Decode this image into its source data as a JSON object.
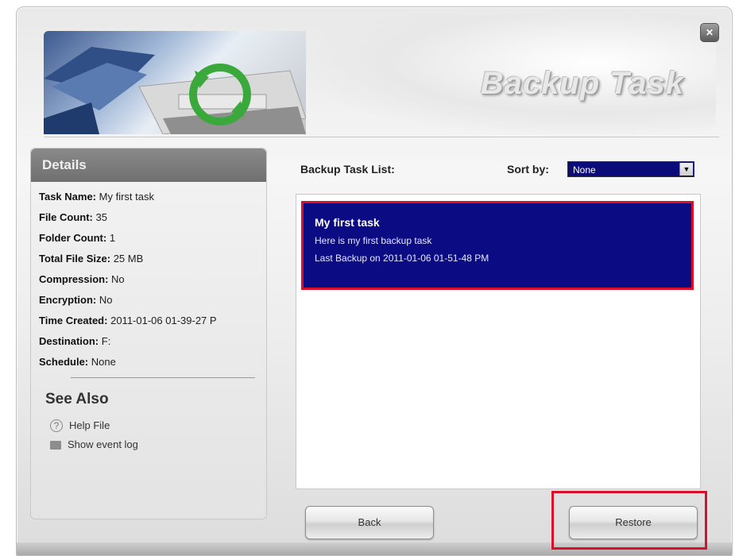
{
  "window": {
    "title": "Backup Task",
    "close_label": "✕"
  },
  "details": {
    "header": "Details",
    "rows": [
      {
        "label": "Task Name:",
        "value": "My first task"
      },
      {
        "label": "File Count:",
        "value": "35"
      },
      {
        "label": "Folder Count:",
        "value": "1"
      },
      {
        "label": "Total File Size:",
        "value": "25 MB"
      },
      {
        "label": "Compression:",
        "value": "No"
      },
      {
        "label": "Encryption:",
        "value": "No"
      },
      {
        "label": "Time Created:",
        "value": "2011-01-06 01-39-27 P"
      },
      {
        "label": "Destination:",
        "value": "F:"
      },
      {
        "label": "Schedule:",
        "value": "None"
      }
    ],
    "see_also": {
      "title": "See Also",
      "items": [
        {
          "label": "Help File",
          "icon": "help-icon"
        },
        {
          "label": "Show event log",
          "icon": "event-log-icon"
        }
      ]
    }
  },
  "task_list": {
    "label": "Backup Task List:",
    "sort_label": "Sort by:",
    "sort_value": "None",
    "items": [
      {
        "name": "My first task",
        "description": "Here is my first backup task",
        "last_backup": "Last Backup on 2011-01-06 01-51-48 PM"
      }
    ]
  },
  "buttons": {
    "back": "Back",
    "restore": "Restore"
  },
  "colors": {
    "selection": "#0b0b84",
    "highlight": "#d8102a"
  }
}
